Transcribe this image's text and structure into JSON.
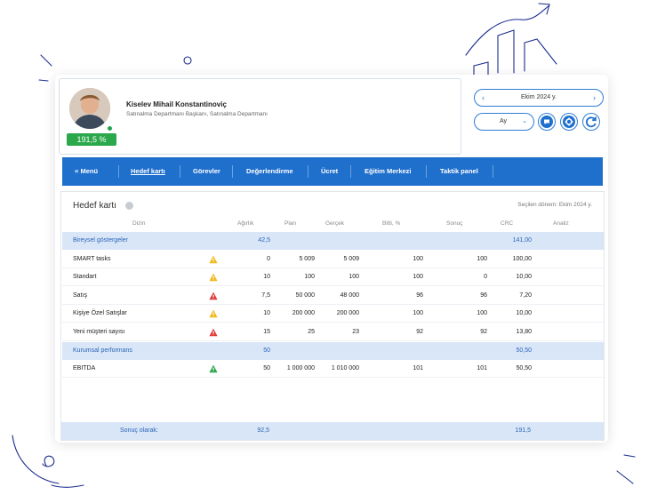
{
  "profile": {
    "name": "Kiselev Mihail Konstantinoviç",
    "subtitle": "Satınalma Departmanı Başkanı, Satınalma Departmanı",
    "percent_badge": "191,5 %"
  },
  "controls": {
    "period_label": "Ekim 2024 y.",
    "view_label": "Ay",
    "prev_arrow": "‹",
    "next_arrow": "›",
    "dropdown_chevron": "⌄"
  },
  "nav": {
    "menu_label": "≡ Menü",
    "items": [
      "Hedef kartı",
      "Görevler",
      "Değerlendirme",
      "Ücret",
      "Eğitim Merkezi",
      "Taktik panel"
    ],
    "active_item": "Hedef kartı",
    "background_color": "#1f6fcc"
  },
  "scorecard": {
    "title": "Hedef kartı",
    "selected_period": "Seçilen dönem: Ekim 2024 y.",
    "columns": [
      "Dizin",
      "Ağırlık",
      "Plan",
      "Gerçek",
      "Bitti, %",
      "Sonuç",
      "CRC",
      "Analiz"
    ],
    "rows": [
      {
        "type": "group",
        "name": "Bireysel göstergeler",
        "weight": "42,5",
        "plan": "",
        "actual": "",
        "done": "",
        "result": "",
        "crc": "141,00",
        "status": ""
      },
      {
        "type": "item",
        "name": "SMART tasks",
        "weight": "0",
        "plan": "5 009",
        "actual": "5 009",
        "done": "100",
        "result": "100",
        "crc": "100,00",
        "status": "warning-yellow"
      },
      {
        "type": "item",
        "name": "Standart",
        "weight": "10",
        "plan": "100",
        "actual": "100",
        "done": "100",
        "result": "0",
        "crc": "10,00",
        "status": "warning-yellow"
      },
      {
        "type": "item",
        "name": "Satış",
        "weight": "7,5",
        "plan": "50 000",
        "actual": "48 000",
        "done": "96",
        "result": "96",
        "crc": "7,20",
        "status": "warning-red"
      },
      {
        "type": "item",
        "name": "Kişiye Özel Satışlar",
        "weight": "10",
        "plan": "200 000",
        "actual": "200 000",
        "done": "100",
        "result": "100",
        "crc": "10,00",
        "status": "warning-yellow"
      },
      {
        "type": "item",
        "name": "Yeni müşteri sayısı",
        "weight": "15",
        "plan": "25",
        "actual": "23",
        "done": "92",
        "result": "92",
        "crc": "13,80",
        "status": "warning-red"
      },
      {
        "type": "group",
        "name": "Kurumsal performans",
        "weight": "50",
        "plan": "",
        "actual": "",
        "done": "",
        "result": "",
        "crc": "50,50",
        "status": ""
      },
      {
        "type": "item",
        "name": "EBITDA",
        "weight": "50",
        "plan": "1 000 000",
        "actual": "1 010 000",
        "done": "101",
        "result": "101",
        "crc": "50,50",
        "status": "ok-green"
      }
    ],
    "total": {
      "label": "Sonuç olarak:",
      "weight": "92,5",
      "crc": "191,5"
    }
  },
  "colors": {
    "accent": "#2e7dd7",
    "group_row_bg": "#d9e6f7",
    "badge_green": "#2aa84a",
    "warning_yellow": "#f2b81c",
    "warning_red": "#e03a3a",
    "ok_green": "#2aa84a"
  },
  "icons": {
    "chat": "chat-icon",
    "settings": "gear-icon",
    "refresh": "refresh-icon",
    "info": "info-icon"
  }
}
